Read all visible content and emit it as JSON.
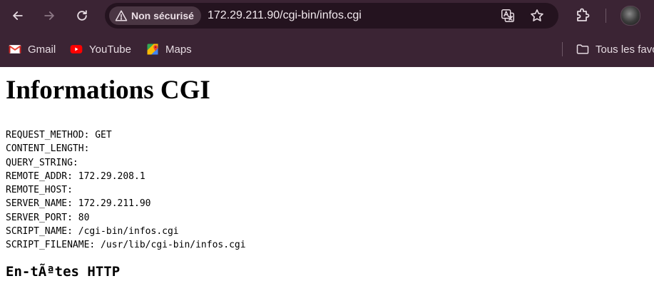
{
  "browser": {
    "security_label": "Non sécurisé",
    "url": "172.29.211.90/cgi-bin/infos.cgi",
    "bookmarks": [
      {
        "label": "Gmail",
        "icon": "gmail-icon"
      },
      {
        "label": "YouTube",
        "icon": "youtube-icon"
      },
      {
        "label": "Maps",
        "icon": "maps-icon"
      }
    ],
    "all_bookmarks_label": "Tous les favo",
    "colors": {
      "frame": "#3b2434",
      "omnibox": "#24131f"
    }
  },
  "page": {
    "title": "Informations CGI",
    "cgi_vars": [
      "REQUEST_METHOD: GET",
      "CONTENT_LENGTH:",
      "QUERY_STRING:",
      "REMOTE_ADDR: 172.29.208.1",
      "REMOTE_HOST:",
      "SERVER_NAME: 172.29.211.90",
      "SERVER_PORT: 80",
      "SCRIPT_NAME: /cgi-bin/infos.cgi",
      "SCRIPT_FILENAME: /usr/lib/cgi-bin/infos.cgi"
    ],
    "section_heading": "En-tÃªtes HTTP"
  }
}
